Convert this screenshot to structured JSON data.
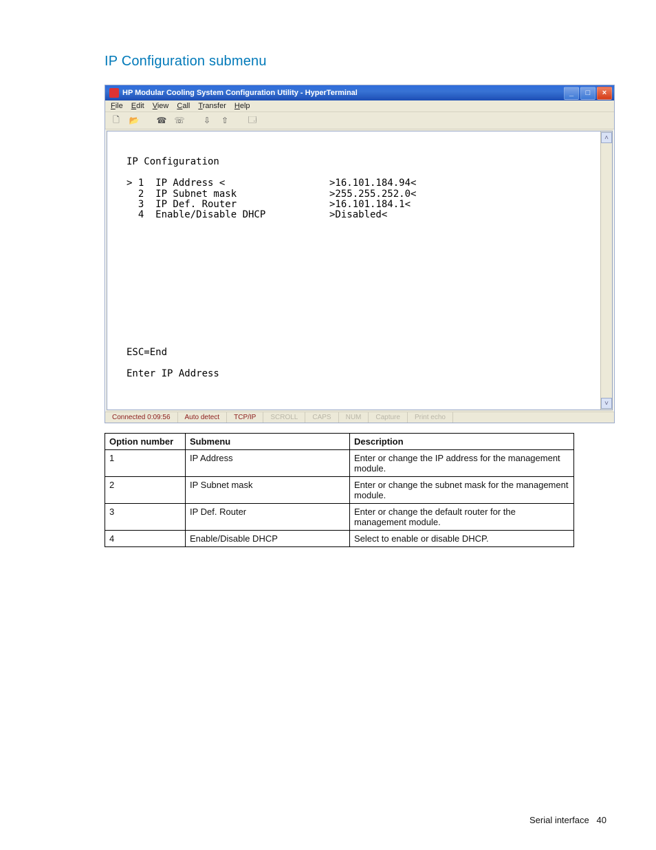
{
  "heading": "IP Configuration submenu",
  "window": {
    "title": "HP Modular Cooling System Configuration Utility - HyperTerminal",
    "menu": [
      "File",
      "Edit",
      "View",
      "Call",
      "Transfer",
      "Help"
    ]
  },
  "terminal": {
    "title": "IP Configuration",
    "rows": [
      {
        "marker": "> 1",
        "label": "IP Address <",
        "value": ">16.101.184.94<"
      },
      {
        "marker": "  2",
        "label": "IP Subnet mask",
        "value": ">255.255.252.0<"
      },
      {
        "marker": "  3",
        "label": "IP Def. Router",
        "value": ">16.101.184.1<"
      },
      {
        "marker": "  4",
        "label": "Enable/Disable DHCP",
        "value": ">Disabled<"
      }
    ],
    "esc": "ESC=End",
    "prompt": "Enter IP Address"
  },
  "status": {
    "conn": "Connected 0:09:56",
    "detect": "Auto detect",
    "proto": "TCP/IP",
    "s1": "SCROLL",
    "s2": "CAPS",
    "s3": "NUM",
    "s4": "Capture",
    "s5": "Print echo"
  },
  "table": {
    "headers": {
      "num": "Option number",
      "sub": "Submenu",
      "desc": "Description"
    },
    "rows": [
      {
        "num": "1",
        "sub": "IP Address",
        "desc": "Enter or change the IP address for the management module."
      },
      {
        "num": "2",
        "sub": "IP Subnet mask",
        "desc": "Enter or change the subnet mask for the management module."
      },
      {
        "num": "3",
        "sub": "IP Def. Router",
        "desc": "Enter or change the default router for the management module."
      },
      {
        "num": "4",
        "sub": "Enable/Disable DHCP",
        "desc": "Select to enable or disable DHCP."
      }
    ]
  },
  "footer": {
    "section": "Serial interface",
    "page": "40"
  }
}
